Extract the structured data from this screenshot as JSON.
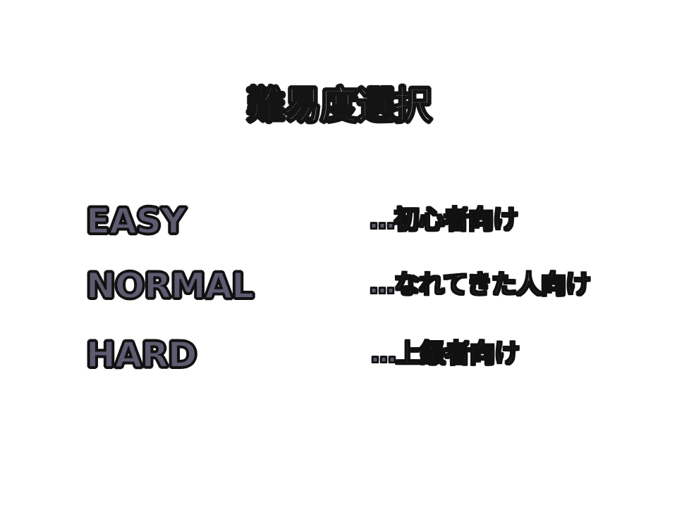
{
  "screen": {
    "title": "難易度選択"
  },
  "difficulty": {
    "options": [
      {
        "label": "EASY",
        "description": "…初心者向け"
      },
      {
        "label": "NORMAL",
        "description": "…なれてきた人向け"
      },
      {
        "label": "HARD",
        "description": "…上級者向け"
      }
    ]
  },
  "colors": {
    "background": "#ffffff",
    "text_fill": "#5e5a70",
    "title_fill": "#ffffff",
    "outline": "#111111"
  }
}
